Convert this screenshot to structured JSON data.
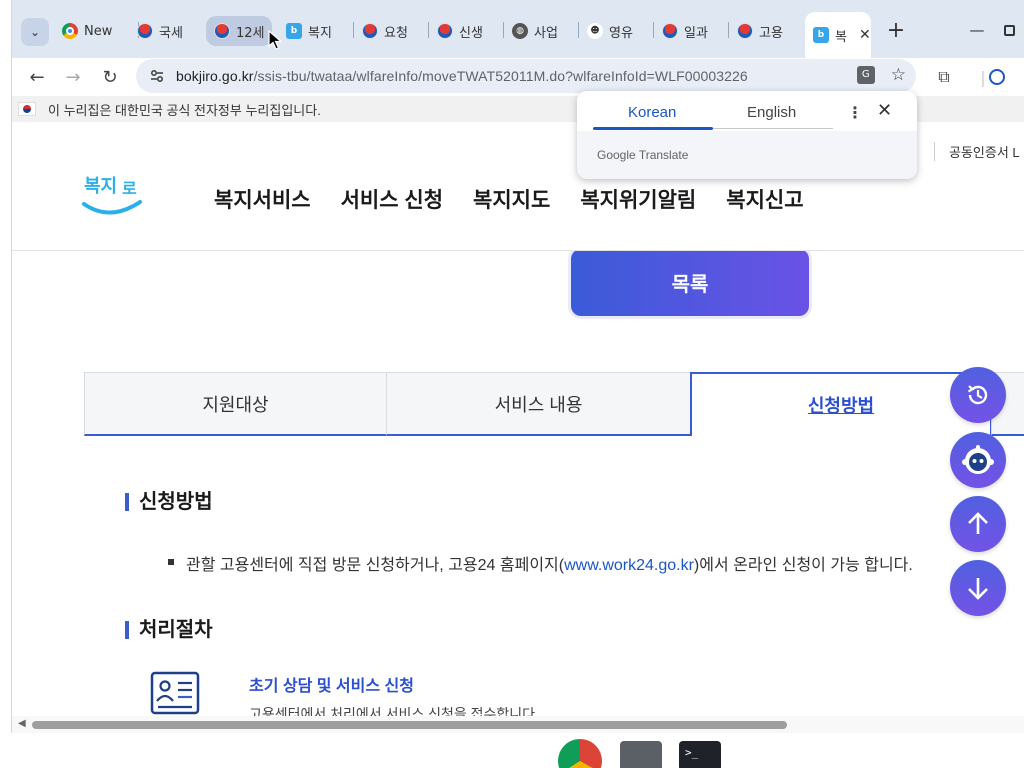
{
  "browser": {
    "tabs": [
      {
        "title": "New",
        "icon": "chrome-icon"
      },
      {
        "title": "국세",
        "icon": "gov-emblem-icon"
      },
      {
        "title": "12세",
        "icon": "gov-emblem-icon"
      },
      {
        "title": "복지",
        "icon": "bokjiro-icon"
      },
      {
        "title": "요청",
        "icon": "gov-emblem-icon"
      },
      {
        "title": "신생",
        "icon": "gov-emblem-icon"
      },
      {
        "title": "사업",
        "icon": "globe-icon"
      },
      {
        "title": "영유",
        "icon": "face-icon"
      },
      {
        "title": "일과",
        "icon": "gov-emblem-icon"
      },
      {
        "title": "고용",
        "icon": "gov-emblem-icon"
      },
      {
        "title": "복",
        "icon": "bokjiro-icon"
      }
    ],
    "url": {
      "host": "bokjiro.go.kr",
      "path": "/ssis-tbu/twataa/wlfareInfo/moveTWAT52011M.do?wlfareInfoId=WLF00003226"
    }
  },
  "gov_banner": {
    "text": "이 누리집은 대한민국 공식 전자정부 누리집입니다."
  },
  "translate_popup": {
    "tab_source": "Korean",
    "tab_target": "English",
    "brand": "Google Translate"
  },
  "site": {
    "logo_text": "복지로",
    "nav": [
      "복지서비스",
      "서비스 신청",
      "복지지도",
      "복지위기알림",
      "복지신고"
    ],
    "cert_link": "공동인증서 L"
  },
  "content": {
    "list_button": "목록",
    "tabs": [
      "지원대상",
      "서비스 내용",
      "신청방법"
    ],
    "active_tab": "신청방법",
    "section1_title": "신청방법",
    "bullet_pre": "관할 고용센터에 직접 방문 신청하거나, 고용24 홈페이지(",
    "bullet_link": "www.work24.go.kr",
    "bullet_post": ")에서 온라인 신청이 가능 합니다.",
    "section2_title": "처리절차",
    "step1_title": "초기 상담 및 서비스 신청",
    "step1_desc": "고용센터에서 처리에서 서비스 신청을 접수합니다."
  },
  "colors": {
    "accent": "#3a5bd8",
    "link": "#1a56c4",
    "tabstrip_bg": "#dfe7f3"
  }
}
